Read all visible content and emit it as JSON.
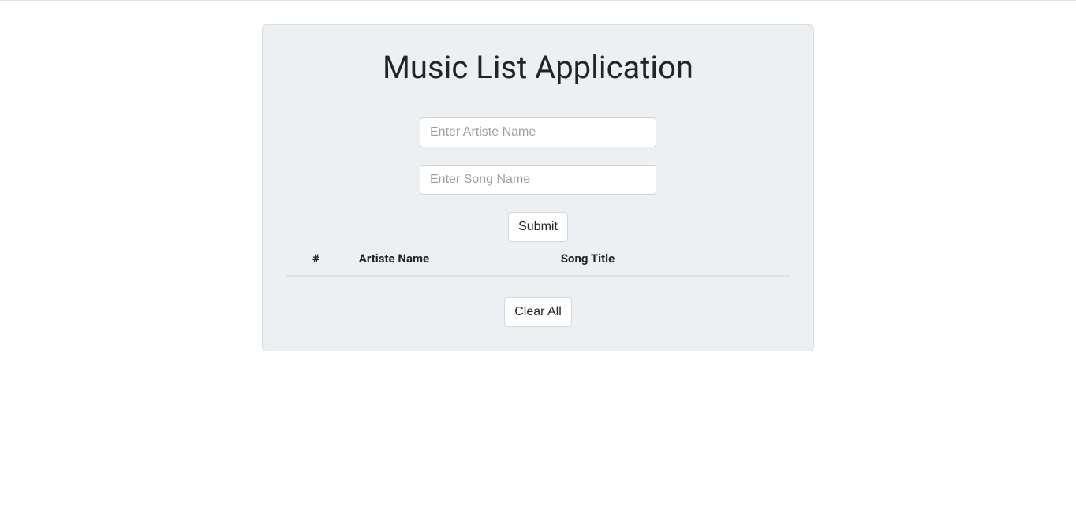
{
  "header": {
    "title": "Music List Application"
  },
  "form": {
    "artiste_placeholder": "Enter Artiste Name",
    "song_placeholder": "Enter Song Name",
    "submit_label": "Submit"
  },
  "table": {
    "headers": {
      "index": "#",
      "artiste": "Artiste Name",
      "song": "Song Title"
    },
    "rows": []
  },
  "actions": {
    "clear_label": "Clear All"
  }
}
